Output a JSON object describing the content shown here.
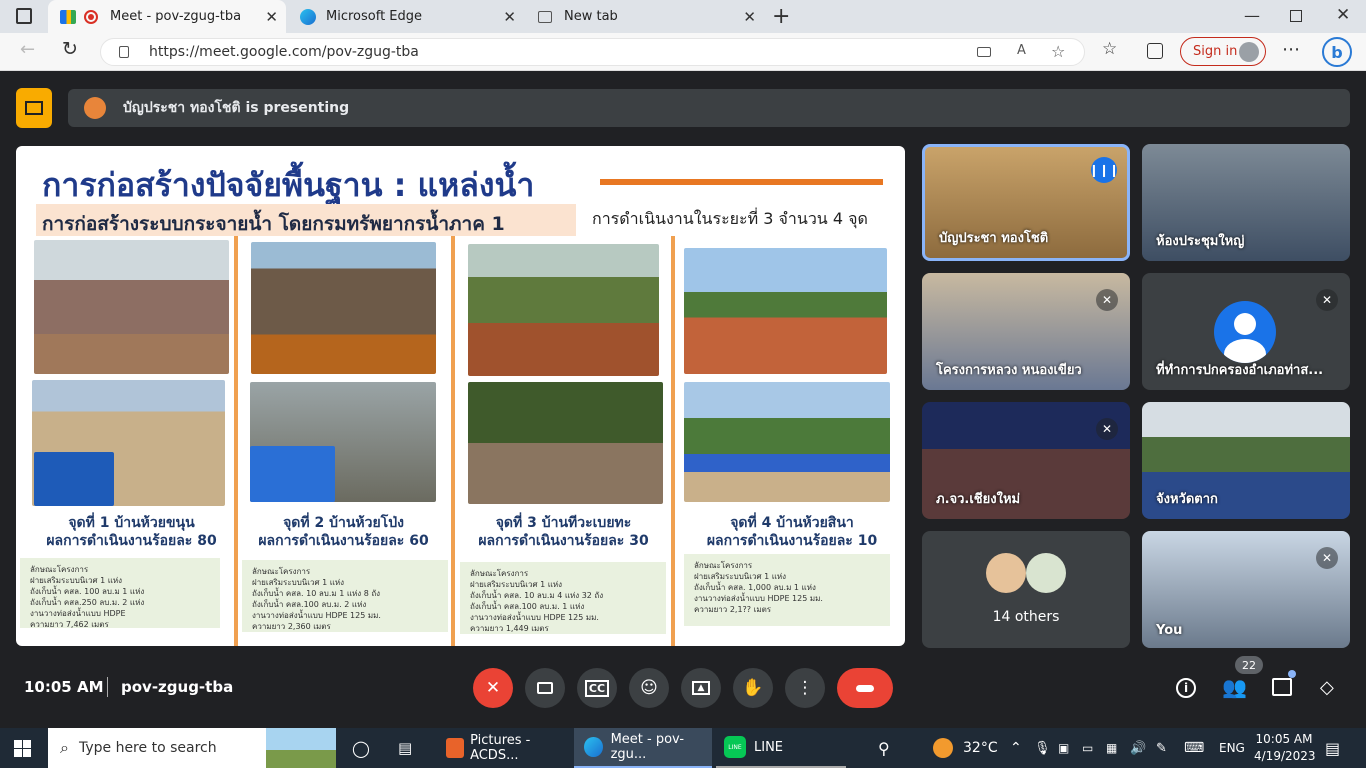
{
  "browser": {
    "tabs": [
      {
        "label": "Meet - pov-zgug-tba"
      },
      {
        "label": "Microsoft Edge"
      },
      {
        "label": "New tab"
      }
    ],
    "url": "https://meet.google.com/pov-zgug-tba",
    "signin_label": "Sign in"
  },
  "meet": {
    "presenter_banner": "บัญประชา ทองโชติ is presenting",
    "time": "10:05 AM",
    "meeting_code": "pov-zgug-tba",
    "people_count": "22",
    "others_label": "14 others",
    "tiles": [
      {
        "name": "บัญประชา ทองโชติ"
      },
      {
        "name": "ห้องประชุมใหญ่"
      },
      {
        "name": "โครงการหลวง หนองเขียว"
      },
      {
        "name": "ที่ทำการปกครองอำเภอท่าส..."
      },
      {
        "name": "ภ.จว.เชียงใหม่"
      },
      {
        "name": "จังหวัดตาก"
      },
      {
        "name": "You"
      }
    ]
  },
  "slide": {
    "title": "การก่อสร้างปัจจัยพื้นฐาน : แหล่งน้ำ",
    "subtitle": "การก่อสร้างระบบกระจายน้ำ โดยกรมทรัพยากรน้ำภาค 1",
    "phase": "การดำเนินงานในระยะที่ 3 จำนวน 4 จุด",
    "points": [
      {
        "line1": "จุดที่ 1 บ้านห้วยขนุน",
        "line2": "ผลการดำเนินงานร้อยละ 80",
        "notes": [
          "ลักษณะโครงการ",
          "ฝายเสริมระบบนิเวศ 1 แห่ง",
          "ถังเก็บน้ำ คสล. 100 ลบ.ม 1 แห่ง",
          "ถังเก็บน้ำ คสล.250 ลบ.ม. 2 แห่ง",
          "งานวางท่อส่งน้ำแบบ HDPE",
          "ความยาว 7,462 เมตร"
        ]
      },
      {
        "line1": "จุดที่ 2 บ้านห้วยโป่ง",
        "line2": "ผลการดำเนินงานร้อยละ 60",
        "notes": [
          "ลักษณะโครงการ",
          "ฝายเสริมระบบนิเวศ 1 แห่ง",
          "ถังเก็บน้ำ คสล. 10 ลบ.ม 1 แห่ง 8 ถัง",
          "ถังเก็บน้ำ คสล.100 ลบ.ม. 2 แห่ง",
          "งานวางท่อส่งน้ำแบบ HDPE 125 มม.",
          "ความยาว 2,360 เมตร"
        ]
      },
      {
        "line1": "จุดที่ 3 บ้านทีวะเบยทะ",
        "line2": "ผลการดำเนินงานร้อยละ 30",
        "notes": [
          "ลักษณะโครงการ",
          "ฝายเสริมระบบนิเวศ 1 แห่ง",
          "ถังเก็บน้ำ คสล. 10 ลบ.ม 4 แห่ง 32 ถัง",
          "ถังเก็บน้ำ คสล.100 ลบ.ม. 1 แห่ง",
          "งานวางท่อส่งน้ำแบบ HDPE 125 มม.",
          "ความยาว 1,449 เมตร"
        ]
      },
      {
        "line1": "จุดที่ 4 บ้านห้วยสินา",
        "line2": "ผลการดำเนินงานร้อยละ 10",
        "notes": [
          "ลักษณะโครงการ",
          "ฝายเสริมระบบนิเวศ 1 แห่ง",
          "ถังเก็บน้ำ คสล. 1,000 ลบ.ม 1 แห่ง",
          "งานวางท่อส่งน้ำแบบ HDPE 125 มม.",
          "ความยาว 2,1?? เมตร"
        ]
      }
    ]
  },
  "taskbar": {
    "search_placeholder": "Type here to search",
    "apps": [
      {
        "label": "Pictures - ACDS..."
      },
      {
        "label": "Meet - pov-zgu..."
      },
      {
        "label": "LINE"
      }
    ],
    "temperature": "32°C",
    "language": "ENG",
    "clock_time": "10:05 AM",
    "clock_date": "4/19/2023"
  }
}
